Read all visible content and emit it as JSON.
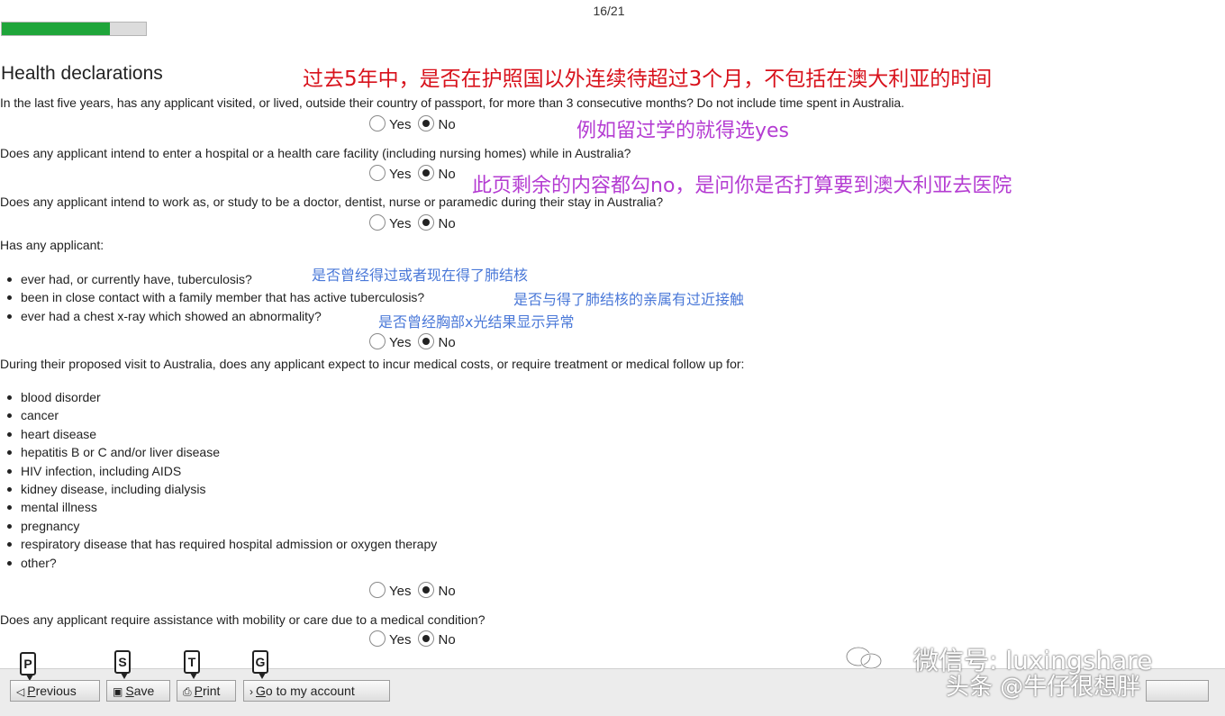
{
  "page_counter": "16/21",
  "progress": {
    "fraction": 0.75,
    "fill_color": "#1fa53a"
  },
  "section_title": "Health declarations",
  "options": {
    "yes": "Yes",
    "no": "No"
  },
  "questions": {
    "q1": "In the last five years, has any applicant visited, or lived, outside their country of passport, for more than 3 consecutive months? Do not include time spent in Australia.",
    "q2": "Does any applicant intend to enter a hospital or a health care facility (including nursing homes) while in Australia?",
    "q3": "Does any applicant intend to work as, or study to be a doctor, dentist, nurse or paramedic during their stay in Australia?",
    "q4": "Has any applicant:",
    "q4_items": [
      "ever had, or currently have, tuberculosis?",
      "been in close contact with a family member that has active tuberculosis?",
      "ever had a chest x-ray which showed an abnormality?"
    ],
    "q5": "During their proposed visit to Australia, does any applicant expect to incur medical costs, or require treatment or medical follow up for:",
    "q5_items": [
      "blood disorder",
      "cancer",
      "heart disease",
      "hepatitis B or C and/or liver disease",
      "HIV infection, including AIDS",
      "kidney disease, including dialysis",
      "mental illness",
      "pregnancy",
      "respiratory disease that has required hospital admission or oxygen therapy",
      "other?"
    ],
    "q6": "Does any applicant require assistance with mobility or care due to a medical condition?"
  },
  "selected_answer": "No",
  "annotations": {
    "red_top": "过去5年中，是否在护照国以外连续待超过3个月，不包括在澳大利亚的时间",
    "purple_yes": "例如留过学的就得选yes",
    "purple_no": "此页剩余的内容都勾no，是问你是否打算要到澳大利亚去医院",
    "blue_tb": "是否曾经得过或者现在得了肺结核",
    "blue_contact": "是否与得了肺结核的亲属有过近接触",
    "blue_xray": "是否曾经胸部x光结果显示异常"
  },
  "footer": {
    "previous": "Previous",
    "save": "Save",
    "print": "Print",
    "account": "Go to my account",
    "keys": [
      "P",
      "S",
      "T",
      "G"
    ]
  },
  "watermark": {
    "wechat": "微信号: luxingshare",
    "toutiao": "头条 @牛仔很想胖"
  },
  "colors": {
    "annotation_red": "#d8121c",
    "annotation_purple": "#b43cd2",
    "annotation_blue": "#4a78d8"
  }
}
